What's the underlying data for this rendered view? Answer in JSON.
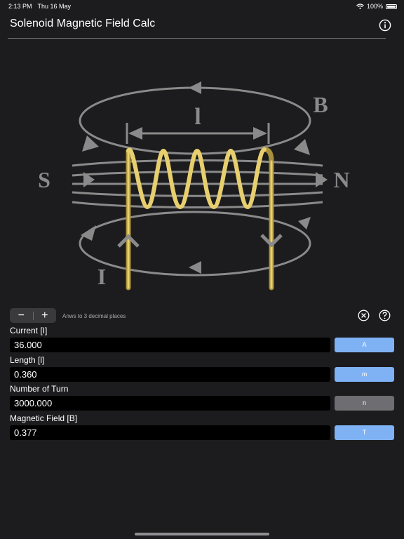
{
  "status_bar": {
    "time": "2:13 PM",
    "date": "Thu 16 May",
    "battery": "100%",
    "icons": [
      "wifi-icon",
      "battery-icon"
    ]
  },
  "nav": {
    "title": "Solenoid Magnetic Field Calc",
    "info_icon": "info-icon"
  },
  "diagram": {
    "labels": {
      "length": "l",
      "field": "B",
      "south": "S",
      "north": "N",
      "current": "I"
    },
    "colors": {
      "field_lines": "#8a8a8a",
      "coil": "#e8cf6e",
      "coil_dark": "#a8913a"
    }
  },
  "controls": {
    "decrement_label": "−",
    "increment_label": "+",
    "hint": "Anws to 3 decimal places",
    "clear_icon": "clear-icon",
    "help_icon": "help-icon"
  },
  "fields": [
    {
      "label": "Current [I]",
      "value": "36.000",
      "unit": "A",
      "unit_color": "#7fb2f5"
    },
    {
      "label": "Length [l]",
      "value": "0.360",
      "unit": "m",
      "unit_color": "#7fb2f5"
    },
    {
      "label": "Number of Turn",
      "value": "3000.000",
      "unit": "n",
      "unit_color": "#6e6e72"
    },
    {
      "label": "Magnetic Field [B]",
      "value": "0.377",
      "unit": "T",
      "unit_color": "#7fb2f5"
    }
  ]
}
